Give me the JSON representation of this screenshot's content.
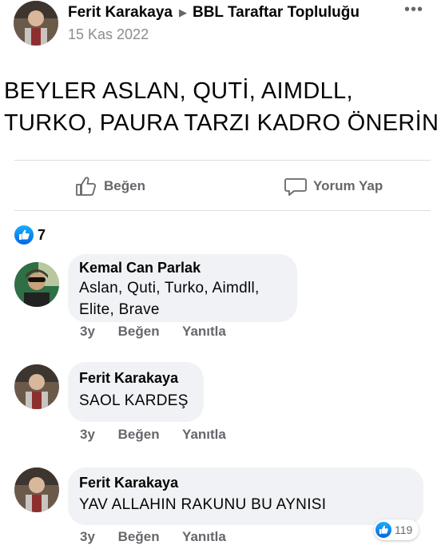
{
  "post": {
    "author": "Ferit Karakaya",
    "group": "BBL Taraftar Topluluğu",
    "date": "15 Kas 2022",
    "text": "BEYLER ASLAN, QUTİ, AIMDLL, TURKO, PAURA TARZI KADRO ÖNERİN",
    "more_icon": "•••"
  },
  "actions": {
    "like_label": "Beğen",
    "comment_label": "Yorum Yap"
  },
  "reactions": {
    "count": "7"
  },
  "comments": [
    {
      "author": "Kemal Can Parlak",
      "text": "Aslan, Quti, Turko, Aimdll, Elite, Brave",
      "time": "3y",
      "like": "Beğen",
      "reply": "Yanıtla"
    },
    {
      "author": "Ferit Karakaya",
      "text": "SAOL KARDEŞ",
      "time": "3y",
      "like": "Beğen",
      "reply": "Yanıtla"
    },
    {
      "author": "Ferit Karakaya",
      "text": "YAV ALLAHIN RAKUNU BU AYNISI",
      "time": "3y",
      "like": "Beğen",
      "reply": "Yanıtla",
      "likes": "119"
    }
  ],
  "colors": {
    "like_blue": "#1877f2",
    "meta_gray": "#65676b",
    "bubble": "#f0f2f5"
  }
}
